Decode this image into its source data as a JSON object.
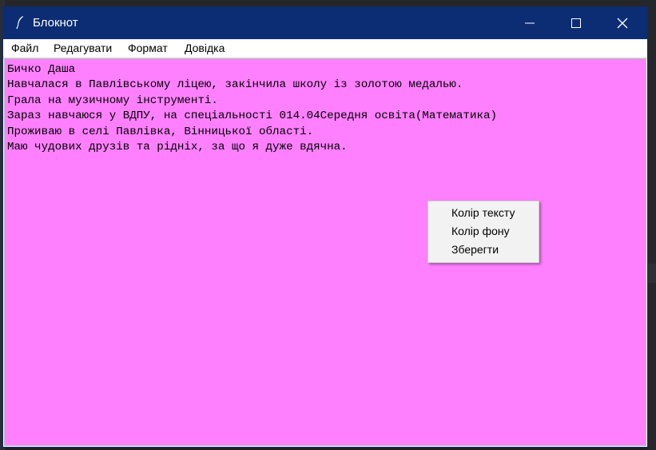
{
  "window": {
    "title": "Блокнот",
    "icon": "feather-icon",
    "controls": [
      "minimize-icon",
      "maximize-icon",
      "close-icon"
    ]
  },
  "menubar": {
    "items": [
      "Файл",
      "Редагувати",
      "Формат",
      "Довідка"
    ]
  },
  "editor": {
    "background_color": "#ff80ff",
    "lines": [
      "Бичко Даша",
      "Навчалася в Павлівському ліцею, закінчила школу із золотою медалью.",
      "Грала на музичному інструменті.",
      "Зараз навчаюся у ВДПУ, на спеціальності 014.04Середня освіта(Математика)",
      "Проживаю в селі Павлівка, Вінницької області.",
      "Маю чудових друзів та рідніх, за що я дуже вдячна."
    ]
  },
  "context_menu": {
    "items": [
      "Колір тексту",
      "Колір фону",
      "Зберегти"
    ]
  },
  "colors": {
    "titlebar": "#0c2d73",
    "text_area": "#ff80ff"
  }
}
